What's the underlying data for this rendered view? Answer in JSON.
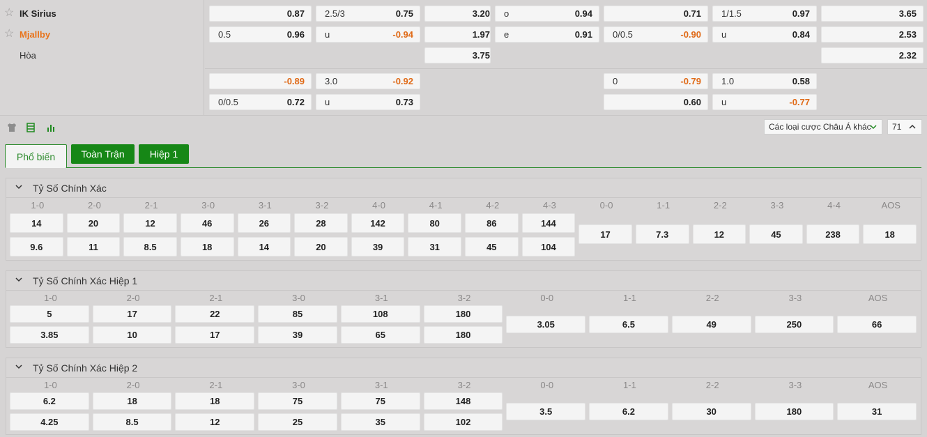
{
  "teams": {
    "home": "IK Sirius",
    "away": "Mjallby",
    "draw": "Hòa"
  },
  "top_markets": {
    "row1": [
      {
        "lbl": "",
        "val": "0.87"
      },
      {
        "lbl": "2.5/3",
        "val": "0.75"
      },
      {
        "lbl": "",
        "val": "3.20"
      },
      {
        "lbl": "o",
        "val": "0.94"
      },
      {
        "lbl": "",
        "val": "0.71"
      },
      {
        "lbl": "1/1.5",
        "val": "0.97"
      },
      {
        "lbl": "",
        "val": "3.65"
      }
    ],
    "row2": [
      {
        "lbl": "0.5",
        "val": "0.96"
      },
      {
        "lbl": "u",
        "val": "-0.94"
      },
      {
        "lbl": "",
        "val": "1.97"
      },
      {
        "lbl": "e",
        "val": "0.91"
      },
      {
        "lbl": "0/0.5",
        "val": "-0.90"
      },
      {
        "lbl": "u",
        "val": "0.84"
      },
      {
        "lbl": "",
        "val": "2.53"
      }
    ],
    "row3": [
      {
        "lbl": "",
        "val": "3.75"
      },
      {
        "lbl": "",
        "val": "2.32"
      }
    ],
    "row4": [
      {
        "lbl": "",
        "val": "-0.89"
      },
      {
        "lbl": "3.0",
        "val": "-0.92"
      },
      {
        "lbl": "0",
        "val": "-0.79"
      },
      {
        "lbl": "1.0",
        "val": "0.58"
      }
    ],
    "row5": [
      {
        "lbl": "0/0.5",
        "val": "0.72"
      },
      {
        "lbl": "u",
        "val": "0.73"
      },
      {
        "lbl": "",
        "val": "0.60"
      },
      {
        "lbl": "u",
        "val": "-0.77"
      }
    ]
  },
  "toolbar": {
    "icons": [
      "jersey-icon",
      "list-icon",
      "bar-chart-icon"
    ],
    "select_label": "Các loại cược Châu Á khác",
    "count": "71"
  },
  "tabs": [
    {
      "label": "Phổ biến",
      "active": true
    },
    {
      "label": "Toàn Trận",
      "active": false
    },
    {
      "label": "Hiệp 1",
      "active": false
    }
  ],
  "sections": [
    {
      "title": "Tỷ Số Chính Xác",
      "labels": [
        "1-0",
        "2-0",
        "2-1",
        "3-0",
        "3-1",
        "3-2",
        "4-0",
        "4-1",
        "4-2",
        "4-3",
        "0-0",
        "1-1",
        "2-2",
        "3-3",
        "4-4",
        "AOS"
      ],
      "home": [
        "14",
        "20",
        "12",
        "46",
        "26",
        "28",
        "142",
        "80",
        "86",
        "144"
      ],
      "away": [
        "9.6",
        "11",
        "8.5",
        "18",
        "14",
        "20",
        "39",
        "31",
        "45",
        "104"
      ],
      "draw": [
        "17",
        "7.3",
        "12",
        "45",
        "238",
        "18"
      ]
    },
    {
      "title": "Tỷ Số Chính Xác Hiệp 1",
      "labels": [
        "1-0",
        "2-0",
        "2-1",
        "3-0",
        "3-1",
        "3-2",
        "0-0",
        "1-1",
        "2-2",
        "3-3",
        "AOS"
      ],
      "home": [
        "5",
        "17",
        "22",
        "85",
        "108",
        "180"
      ],
      "away": [
        "3.85",
        "10",
        "17",
        "39",
        "65",
        "180"
      ],
      "draw": [
        "3.05",
        "6.5",
        "49",
        "250",
        "66"
      ]
    },
    {
      "title": "Tỷ Số Chính Xác Hiệp 2",
      "labels": [
        "1-0",
        "2-0",
        "2-1",
        "3-0",
        "3-1",
        "3-2",
        "0-0",
        "1-1",
        "2-2",
        "3-3",
        "AOS"
      ],
      "home": [
        "6.2",
        "18",
        "18",
        "75",
        "75",
        "148"
      ],
      "away": [
        "4.25",
        "8.5",
        "12",
        "25",
        "35",
        "102"
      ],
      "draw": [
        "3.5",
        "6.2",
        "30",
        "180",
        "31"
      ]
    }
  ],
  "colors": {
    "accent_green": "#168716",
    "negative_orange": "#e06a17",
    "team_orange": "#e8731a"
  }
}
